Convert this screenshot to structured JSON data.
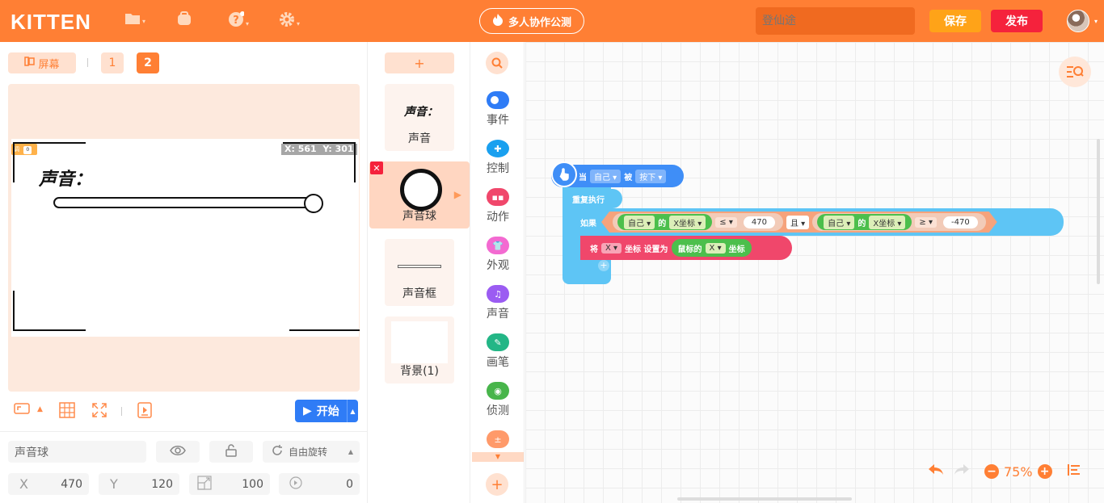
{
  "app": {
    "logo": "KITTEN",
    "collab_label": "多人协作公测",
    "project_name_placeholder": "登仙途",
    "save_label": "保存",
    "publish_label": "发布",
    "accent_color": "#ff7f34"
  },
  "stage_panel": {
    "screen_tab": "屏幕",
    "screen_numbers": [
      "1",
      "2"
    ],
    "active_screen": "2",
    "coords": {
      "x_label": "X: 561",
      "y_label": "Y: 301"
    },
    "stage_text": "声音：",
    "start_label": "开始"
  },
  "sprite_props": {
    "name": "声音球",
    "rotation_mode": "自由旋转",
    "x_label": "X",
    "x": "470",
    "y_label": "Y",
    "y": "120",
    "size": "100",
    "direction": "0"
  },
  "sprites": {
    "add_label": "+",
    "items": [
      {
        "label": "声音",
        "thumb_text": "声音："
      },
      {
        "label": "声音球",
        "selected": true
      },
      {
        "label": "声音框"
      },
      {
        "label": "背景(1)"
      }
    ]
  },
  "categories": [
    {
      "label": "事件",
      "color": "#2f7cf6",
      "icon": "toggle-icon"
    },
    {
      "label": "控制",
      "color": "#1aa0ef",
      "icon": "control-icon"
    },
    {
      "label": "动作",
      "color": "#f0476b",
      "icon": "ghost-icon"
    },
    {
      "label": "外观",
      "color": "#f36ad1",
      "icon": "shirt-icon"
    },
    {
      "label": "声音",
      "color": "#9b5cf2",
      "icon": "music-icon"
    },
    {
      "label": "画笔",
      "color": "#23b686",
      "icon": "pen-icon"
    },
    {
      "label": "侦测",
      "color": "#48b54b",
      "icon": "detect-icon"
    },
    {
      "label": "",
      "color": "#ff9a6a",
      "icon": "operator-icon"
    }
  ],
  "blocks": {
    "hat": {
      "when": "当",
      "self": "自己",
      "was": "被",
      "pressed": "按下"
    },
    "repeat": "重复执行",
    "if": {
      "label": "如果",
      "left": {
        "self": "自己",
        "of": "的",
        "prop": "X坐标",
        "op": "≤",
        "value": "470"
      },
      "and": "且",
      "right": {
        "self": "自己",
        "of": "的",
        "prop": "X坐标",
        "op": "≥",
        "value": "-470"
      }
    },
    "set": {
      "label": "将",
      "axis": "X",
      "coord_set": "坐标 设置为",
      "mouse": "鼠标的",
      "axis2": "X",
      "coord": "坐标"
    }
  },
  "zoom": {
    "level": "75%"
  }
}
